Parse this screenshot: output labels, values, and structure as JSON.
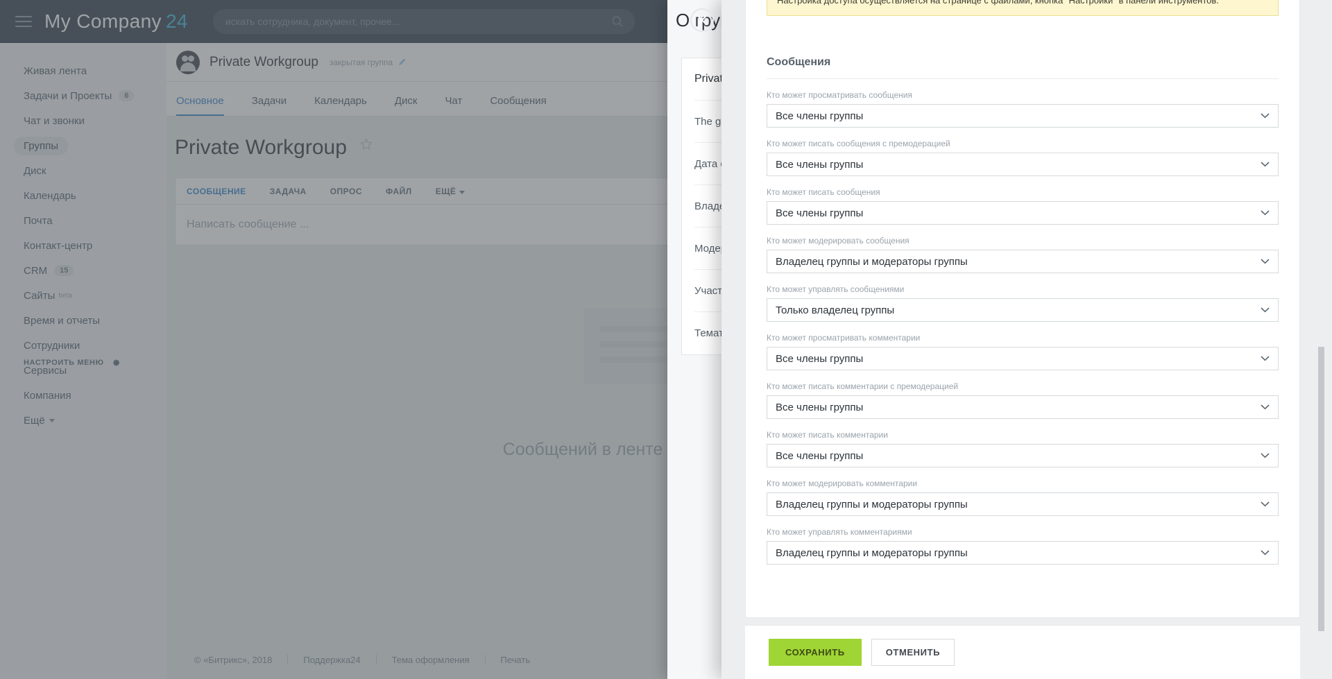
{
  "topbar": {
    "logo_text": "My Company",
    "logo_number": "24",
    "search_placeholder": "искать сотрудника, документ, прочее...",
    "search_value": ""
  },
  "sidebar": {
    "items": [
      {
        "label": "Живая лента",
        "badge": "",
        "beta": false
      },
      {
        "label": "Задачи и Проекты",
        "badge": "6",
        "beta": false
      },
      {
        "label": "Чат и звонки",
        "badge": "",
        "beta": false
      },
      {
        "label": "Группы",
        "badge": "",
        "beta": false
      },
      {
        "label": "Диск",
        "badge": "",
        "beta": false
      },
      {
        "label": "Календарь",
        "badge": "",
        "beta": false
      },
      {
        "label": "Почта",
        "badge": "",
        "beta": false
      },
      {
        "label": "Контакт-центр",
        "badge": "",
        "beta": false
      },
      {
        "label": "CRM",
        "badge": "15",
        "beta": false
      },
      {
        "label": "Сайты",
        "badge": "",
        "beta": true
      },
      {
        "label": "Время и отчеты",
        "badge": "",
        "beta": false
      },
      {
        "label": "Сотрудники",
        "badge": "",
        "beta": false
      },
      {
        "label": "Сервисы",
        "badge": "",
        "beta": false
      },
      {
        "label": "Компания",
        "badge": "",
        "beta": false
      },
      {
        "label": "Ещё",
        "badge": "",
        "beta": false
      }
    ],
    "beta_label": "beta",
    "configure_menu": "НАСТРОИТЬ МЕНЮ"
  },
  "workgroup": {
    "name": "Private Workgroup",
    "privacy": "закрытая группа",
    "tabs": [
      "Основное",
      "Задачи",
      "Календарь",
      "Диск",
      "Чат",
      "Сообщения"
    ],
    "active_tab": "Основное",
    "page_title": "Private Workgroup",
    "post_tabs": [
      "СООБЩЕНИЕ",
      "ЗАДАЧА",
      "ОПРОС",
      "ФАЙЛ",
      "ЕЩЁ"
    ],
    "active_post_tab": "СООБЩЕНИЕ",
    "composer_placeholder": "Написать сообщение ...",
    "feed_empty_text": "Сообщений в ленте"
  },
  "footer": {
    "copyright": "© «Битрикс», 2018",
    "links": [
      "Поддержка24",
      "Тема оформления",
      "Печать"
    ]
  },
  "bg_panel": {
    "title": "О группе",
    "rows": [
      "Private Workgroup",
      "The group",
      "Дата созда",
      "Владелец",
      "Модерато",
      "Участники",
      "Тематика"
    ]
  },
  "slider": {
    "notice": "Настройка доступа осуществляется на странице с файлами, кнопка \"Настройки\" в панели инструментов.",
    "section_title": "Сообщения",
    "fields": [
      {
        "label": "Кто может просматривать сообщения",
        "value": "Все члены группы"
      },
      {
        "label": "Кто может писать сообщения с премодерацией",
        "value": "Все члены группы"
      },
      {
        "label": "Кто может писать сообщения",
        "value": "Все члены группы"
      },
      {
        "label": "Кто может модерировать сообщения",
        "value": "Владелец группы и модераторы группы"
      },
      {
        "label": "Кто может управлять сообщениями",
        "value": "Только владелец группы"
      },
      {
        "label": "Кто может просматривать комментарии",
        "value": "Все члены группы"
      },
      {
        "label": "Кто может писать комментарии с премодерацией",
        "value": "Все члены группы"
      },
      {
        "label": "Кто может писать комментарии",
        "value": "Все члены группы"
      },
      {
        "label": "Кто может модерировать комментарии",
        "value": "Владелец группы и модераторы группы"
      },
      {
        "label": "Кто может управлять комментариями",
        "value": "Владелец группы и модераторы группы"
      }
    ],
    "save_label": "СОХРАНИТЬ",
    "cancel_label": "ОТМЕНИТЬ"
  },
  "right_rail": {
    "help_glyph": "?",
    "items": [
      "help-icon",
      "notifications-icon",
      "messenger-icon",
      "search-icon",
      "user-avatar",
      "phone-icon"
    ]
  },
  "colors": {
    "accent_blue": "#2f7ec4",
    "save_green": "#9fd534",
    "notice_yellow": "#fdf6cf",
    "topbar_dark": "#2e3b48"
  }
}
